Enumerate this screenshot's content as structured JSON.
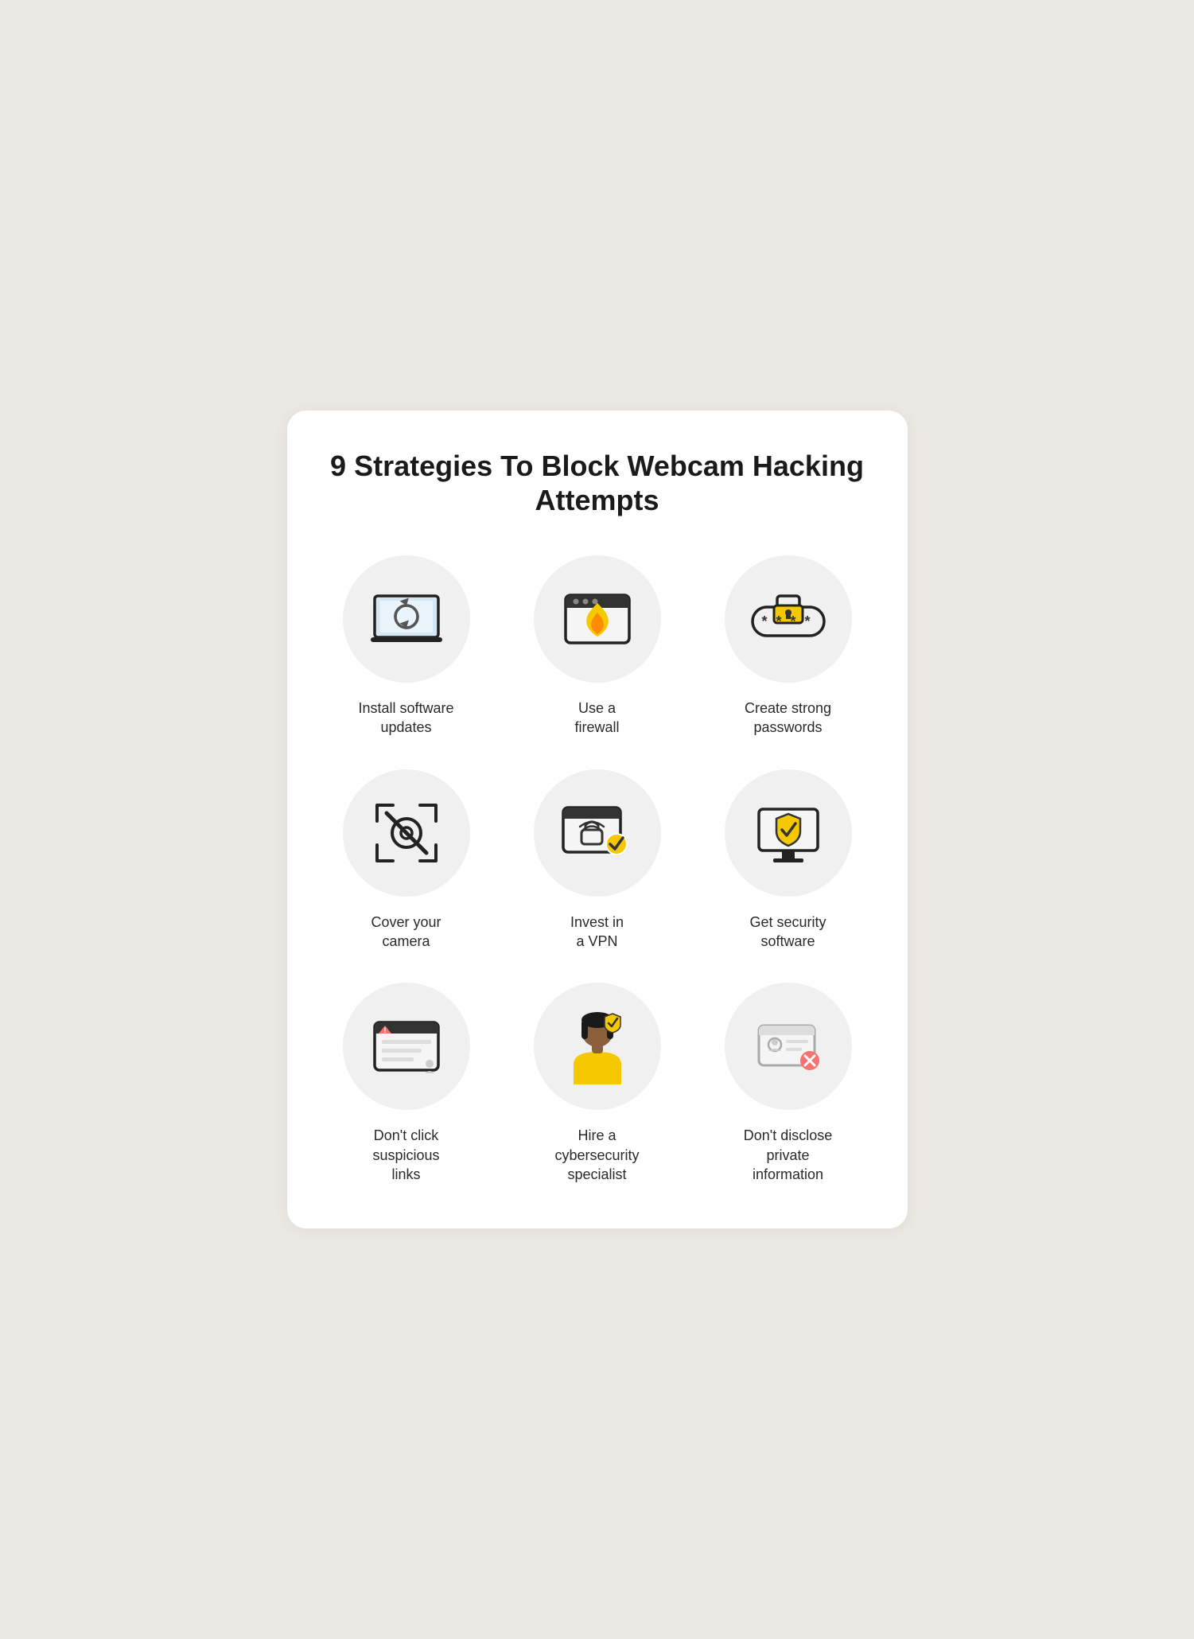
{
  "title": "9 Strategies To Block Webcam Hacking Attempts",
  "items": [
    {
      "id": "install-updates",
      "label": "Install software updates",
      "icon": "laptop-refresh"
    },
    {
      "id": "use-firewall",
      "label": "Use a firewall",
      "icon": "firewall"
    },
    {
      "id": "strong-passwords",
      "label": "Create strong passwords",
      "icon": "password"
    },
    {
      "id": "cover-camera",
      "label": "Cover your camera",
      "icon": "camera-off"
    },
    {
      "id": "invest-vpn",
      "label": "Invest in a VPN",
      "icon": "vpn"
    },
    {
      "id": "security-software",
      "label": "Get security software",
      "icon": "security-software"
    },
    {
      "id": "suspicious-links",
      "label": "Don't click suspicious links",
      "icon": "suspicious-links"
    },
    {
      "id": "cybersecurity-specialist",
      "label": "Hire a cybersecurity specialist",
      "icon": "specialist"
    },
    {
      "id": "private-info",
      "label": "Don't disclose private information",
      "icon": "private-info"
    }
  ]
}
